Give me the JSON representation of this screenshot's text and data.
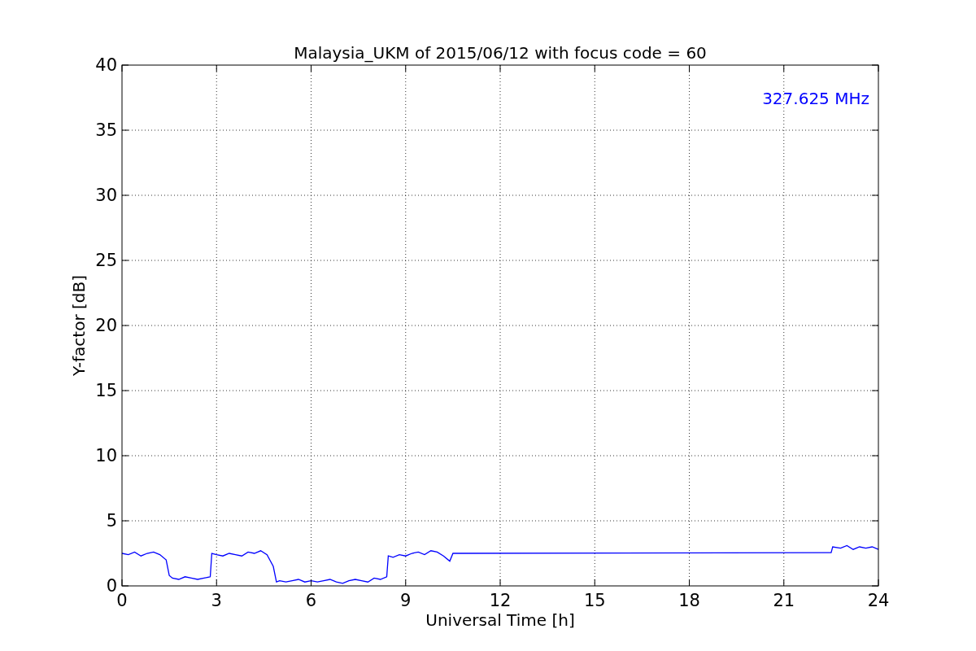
{
  "figure": {
    "chart_data": {
      "type": "line",
      "title": "Malaysia_UKM of 2015/06/12 with focus code = 60",
      "xlabel": "Universal Time [h]",
      "ylabel": "Y-factor [dB]",
      "xlim": [
        0,
        24
      ],
      "ylim": [
        0,
        40
      ],
      "xticks": [
        0,
        3,
        6,
        9,
        12,
        15,
        18,
        21,
        24
      ],
      "yticks": [
        0,
        5,
        10,
        15,
        20,
        25,
        30,
        35,
        40
      ],
      "x": [
        0,
        0.2,
        0.4,
        0.6,
        0.8,
        1.0,
        1.2,
        1.4,
        1.5,
        1.6,
        1.8,
        2.0,
        2.2,
        2.4,
        2.6,
        2.8,
        2.85,
        3.0,
        3.2,
        3.4,
        3.6,
        3.8,
        4.0,
        4.2,
        4.4,
        4.6,
        4.8,
        4.9,
        5.0,
        5.2,
        5.4,
        5.6,
        5.8,
        6.0,
        6.2,
        6.4,
        6.6,
        6.8,
        7.0,
        7.2,
        7.4,
        7.6,
        7.8,
        8.0,
        8.2,
        8.4,
        8.45,
        8.6,
        8.8,
        9.0,
        9.2,
        9.4,
        9.6,
        9.8,
        10.0,
        10.2,
        10.4,
        10.5,
        22.5,
        22.55,
        22.8,
        23.0,
        23.2,
        23.4,
        23.6,
        23.8,
        24
      ],
      "series": [
        {
          "color": "#0000ff",
          "values": [
            2.5,
            2.4,
            2.6,
            2.3,
            2.5,
            2.6,
            2.4,
            2.0,
            0.8,
            0.6,
            0.5,
            0.7,
            0.6,
            0.5,
            0.6,
            0.7,
            2.5,
            2.4,
            2.3,
            2.5,
            2.4,
            2.3,
            2.6,
            2.5,
            2.7,
            2.4,
            1.5,
            0.3,
            0.4,
            0.3,
            0.4,
            0.5,
            0.3,
            0.4,
            0.3,
            0.4,
            0.5,
            0.3,
            0.2,
            0.4,
            0.5,
            0.4,
            0.3,
            0.6,
            0.5,
            0.7,
            2.3,
            2.2,
            2.4,
            2.3,
            2.5,
            2.6,
            2.4,
            2.7,
            2.6,
            2.3,
            1.9,
            2.5,
            2.55,
            3.0,
            2.9,
            3.1,
            2.8,
            3.0,
            2.9,
            3.0,
            2.8
          ]
        }
      ],
      "grid": true,
      "annotations": [
        {
          "text": "327.625 MHz"
        }
      ]
    }
  }
}
